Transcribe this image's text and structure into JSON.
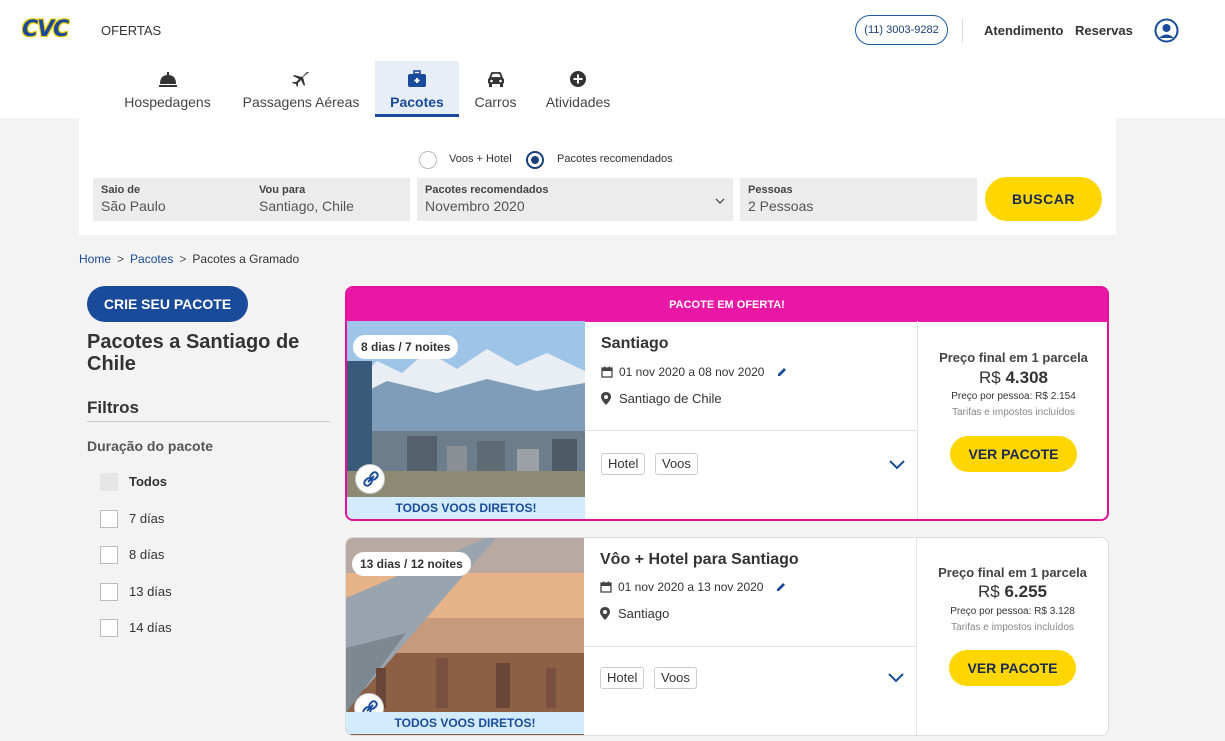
{
  "header": {
    "logo_text": "CVC",
    "ofertas": "OFERTAS",
    "phone": "(11) 3003-9282",
    "atendimento": "Atendimento",
    "reservas": "Reservas"
  },
  "tabs": [
    {
      "label": "Hospedagens",
      "icon": "bell-service-icon"
    },
    {
      "label": "Passagens Aéreas",
      "icon": "airplane-icon"
    },
    {
      "label": "Pacotes",
      "icon": "suitcase-icon",
      "active": true
    },
    {
      "label": "Carros",
      "icon": "car-icon"
    },
    {
      "label": "Atividades",
      "icon": "plus-circle-icon"
    }
  ],
  "search": {
    "options": [
      {
        "label": "Voos + Hotel",
        "selected": false
      },
      {
        "label": "Pacotes recomendados",
        "selected": true
      }
    ],
    "saio_label": "Saio de",
    "saio_value": "São Paulo",
    "vou_label": "Vou para",
    "vou_value": "Santiago, Chile",
    "pacotes_label": "Pacotes recomendados",
    "pacotes_value": "Novembro 2020",
    "pessoas_label": "Pessoas",
    "pessoas_value": "2 Pessoas",
    "button": "BUSCAR"
  },
  "breadcrumb": {
    "home": "Home",
    "pacotes": "Pacotes",
    "current": "Pacotes a Gramado",
    "separator": ">"
  },
  "sidebar": {
    "crie_button": "CRIE SEU PACOTE",
    "title": "Pacotes a Santiago de Chile",
    "filtros": "Filtros",
    "duracao": "Duração do pacote",
    "options": [
      "Todos",
      "7 días",
      "8 días",
      "13 días",
      "14 días"
    ]
  },
  "cards": [
    {
      "promo_label": "PACOTE EM OFERTA!",
      "duration_days": "8 dias /",
      "duration_nights": "7 noites",
      "direct": "TODOS VOOS DIRETOS!",
      "name": "Santiago",
      "dates": "01 nov 2020 a 08 nov 2020",
      "location": "Santiago de Chile",
      "tags": [
        "Hotel",
        "Voos"
      ],
      "price_label": "Preço final em 1 parcela",
      "price_currency": "R$",
      "price_value": "4.308",
      "per_person": "Preço por pessoa: R$ 2.154",
      "taxes": "Tarifas e impostos incluídos",
      "button": "VER PACOTE"
    },
    {
      "duration_days": "13 dias /",
      "duration_nights": "12 noites",
      "direct": "TODOS VOOS DIRETOS!",
      "name": "Vôo + Hotel para Santiago",
      "dates": "01 nov 2020 a 13 nov 2020",
      "location": "Santiago",
      "tags": [
        "Hotel",
        "Voos"
      ],
      "price_label": "Preço final em 1 parcela",
      "price_currency": "R$",
      "price_value": "6.255",
      "per_person": "Preço por pessoa: R$ 3.128",
      "taxes": "Tarifas e impostos incluídos",
      "button": "VER PACOTE"
    }
  ],
  "colors": {
    "brand_blue": "#1a4b9b",
    "accent_yellow": "#ffd600",
    "promo_pink": "#e916a6"
  }
}
